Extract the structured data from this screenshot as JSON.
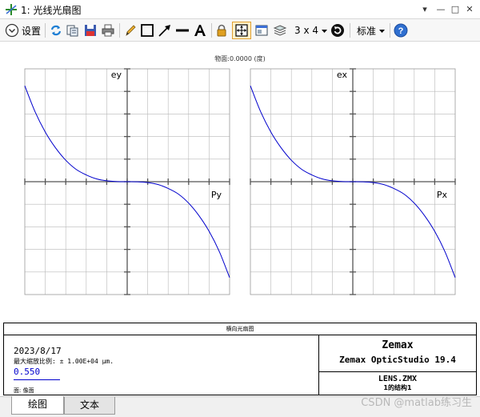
{
  "window": {
    "title": "1: 光线光扇图",
    "min_glyph": "—",
    "max_glyph": "□",
    "close_glyph": "✕"
  },
  "toolbar": {
    "settings_label": "设置",
    "layout_label": "3 x 4",
    "style_label": "标准"
  },
  "plot": {
    "field_label": "物面:0.0000 (度)",
    "left_axis_label": "ey",
    "left_pupil_label": "Py",
    "right_axis_label": "ex",
    "right_pupil_label": "Px"
  },
  "chart_data": [
    {
      "type": "line",
      "xlabel": "Py",
      "ylabel": "ey",
      "xlim": [
        -1,
        1
      ],
      "ylim": [
        -1,
        1
      ],
      "grid": true,
      "series": [
        {
          "color": "#0000cc",
          "x": [
            -1.0,
            -0.9,
            -0.8,
            -0.7,
            -0.6,
            -0.5,
            -0.4,
            -0.3,
            -0.2,
            -0.1,
            0.0,
            0.1,
            0.2,
            0.3,
            0.4,
            0.5,
            0.6,
            0.7,
            0.8,
            0.9,
            1.0
          ],
          "y": [
            0.85,
            0.62,
            0.44,
            0.3,
            0.19,
            0.11,
            0.06,
            0.025,
            0.008,
            0.001,
            0.0,
            -0.001,
            -0.008,
            -0.025,
            -0.06,
            -0.11,
            -0.19,
            -0.3,
            -0.44,
            -0.62,
            -0.85
          ]
        }
      ]
    },
    {
      "type": "line",
      "xlabel": "Px",
      "ylabel": "ex",
      "xlim": [
        -1,
        1
      ],
      "ylim": [
        -1,
        1
      ],
      "grid": true,
      "series": [
        {
          "color": "#0000cc",
          "x": [
            -1.0,
            -0.9,
            -0.8,
            -0.7,
            -0.6,
            -0.5,
            -0.4,
            -0.3,
            -0.2,
            -0.1,
            0.0,
            0.1,
            0.2,
            0.3,
            0.4,
            0.5,
            0.6,
            0.7,
            0.8,
            0.9,
            1.0
          ],
          "y": [
            0.85,
            0.62,
            0.44,
            0.3,
            0.19,
            0.11,
            0.06,
            0.025,
            0.008,
            0.001,
            0.0,
            -0.001,
            -0.008,
            -0.025,
            -0.06,
            -0.11,
            -0.19,
            -0.3,
            -0.44,
            -0.62,
            -0.85
          ]
        }
      ]
    }
  ],
  "info": {
    "title": "横向光扇图",
    "date": "2023/8/17",
    "scale_text": "最大缩放比例: ± 1.00E+04 µm.",
    "wavelength": "0.550",
    "surface_text": "面: 像面",
    "brand": "Zemax",
    "product": "Zemax OpticStudio 19.4",
    "file_name": "LENS.ZMX",
    "config": "1的结构1"
  },
  "tabs": [
    {
      "label": "绘图"
    },
    {
      "label": "文本"
    }
  ],
  "watermark": "CSDN @matlab练习生",
  "colors": {
    "curve": "#0000cc",
    "grid": "#b8b8b8",
    "axis": "#555555"
  }
}
